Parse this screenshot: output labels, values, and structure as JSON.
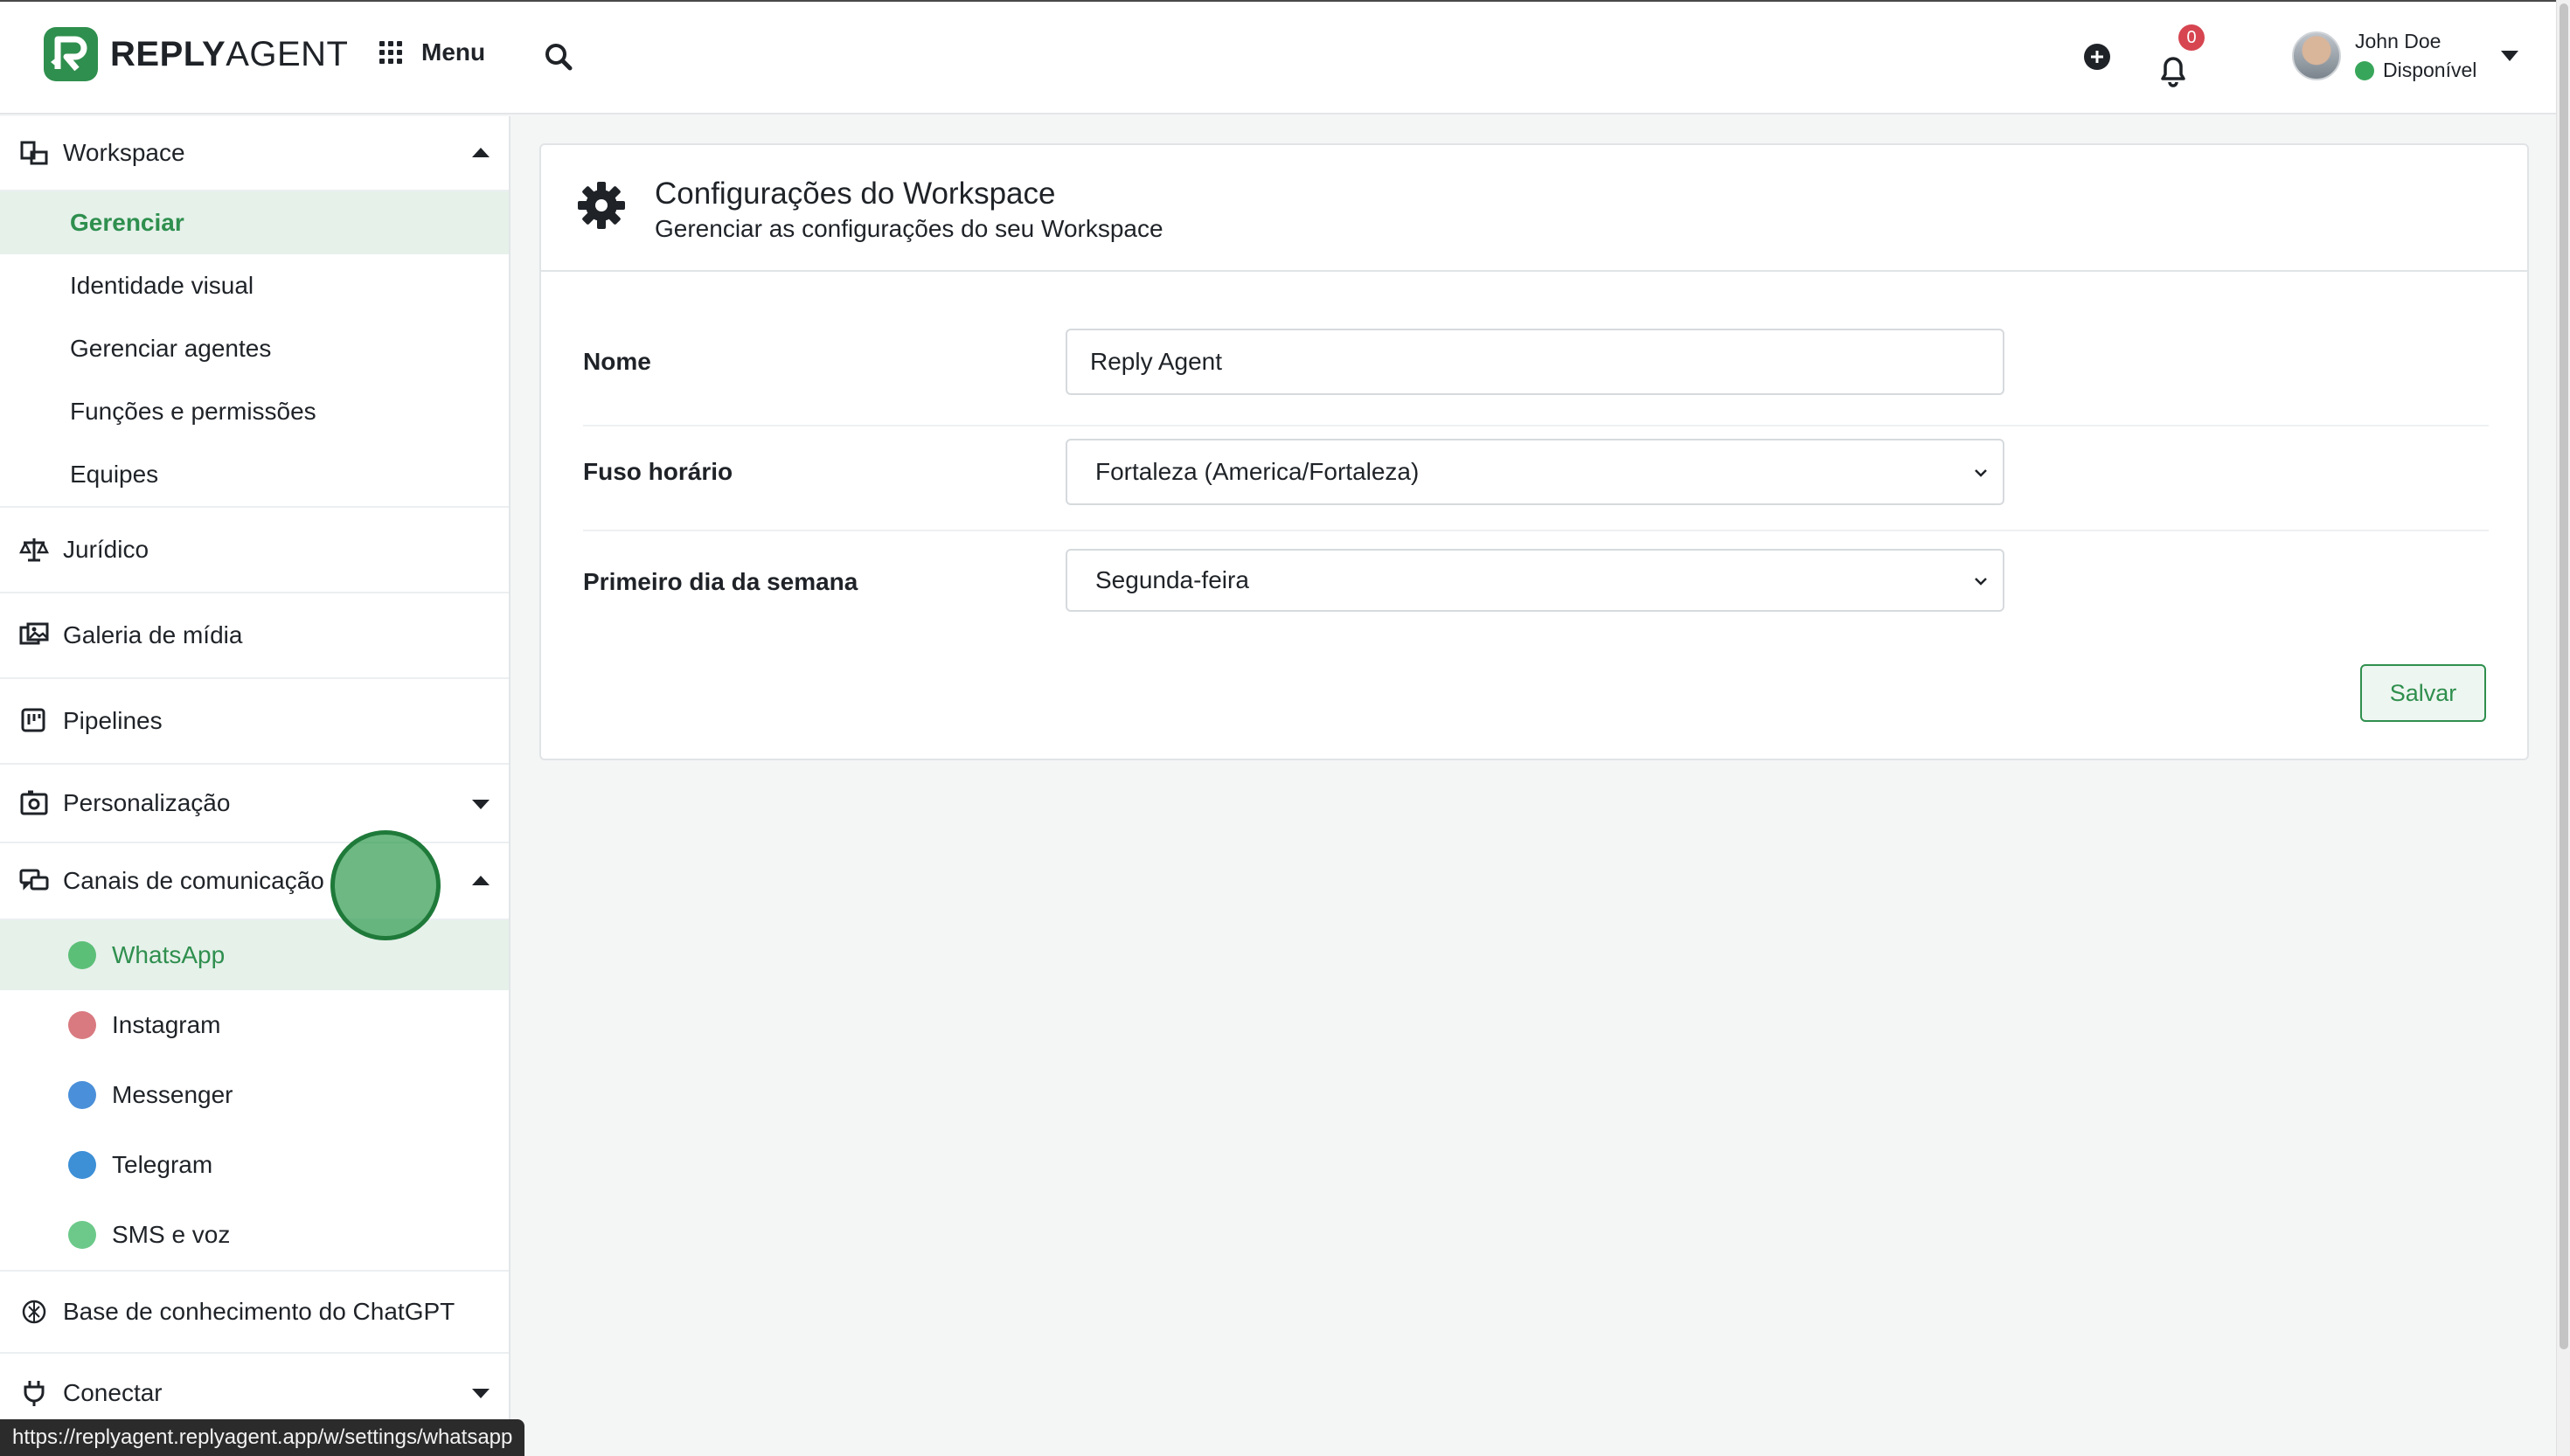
{
  "app": {
    "logo_bold": "REPLY",
    "logo_light": "AGENT"
  },
  "topbar": {
    "menu_label": "Menu",
    "notifications_count": "0",
    "user": {
      "name": "John Doe",
      "status": "Disponível"
    }
  },
  "sidebar": {
    "workspace": "Workspace",
    "workspace_items": [
      "Gerenciar",
      "Identidade visual",
      "Gerenciar agentes",
      "Funções e permissões",
      "Equipes"
    ],
    "juridico": "Jurídico",
    "galeria": "Galeria de mídia",
    "pipelines": "Pipelines",
    "personalizacao": "Personalização",
    "canais": "Canais de comunicação",
    "canais_items": [
      "WhatsApp",
      "Instagram",
      "Messenger",
      "Telegram",
      "SMS e voz"
    ],
    "chatgpt": "Base de conhecimento do ChatGPT",
    "conectar": "Conectar"
  },
  "card": {
    "title": "Configurações do Workspace",
    "subtitle": "Gerenciar as configurações do seu Workspace",
    "fields": {
      "name_label": "Nome",
      "name_value": "Reply Agent",
      "tz_label": "Fuso horário",
      "tz_value": "Fortaleza (America/Fortaleza)",
      "week_label": "Primeiro dia da semana",
      "week_value": "Segunda-feira"
    },
    "save_label": "Salvar"
  },
  "status_url": "https://replyagent.replyagent.app/w/settings/whatsapp",
  "colors": {
    "accent": "#2f8f4e",
    "whatsapp": "#5cbf78",
    "instagram": "#d97a80",
    "messenger": "#4a8fd9",
    "telegram": "#3d8fd6",
    "sms": "#6cc98a"
  }
}
